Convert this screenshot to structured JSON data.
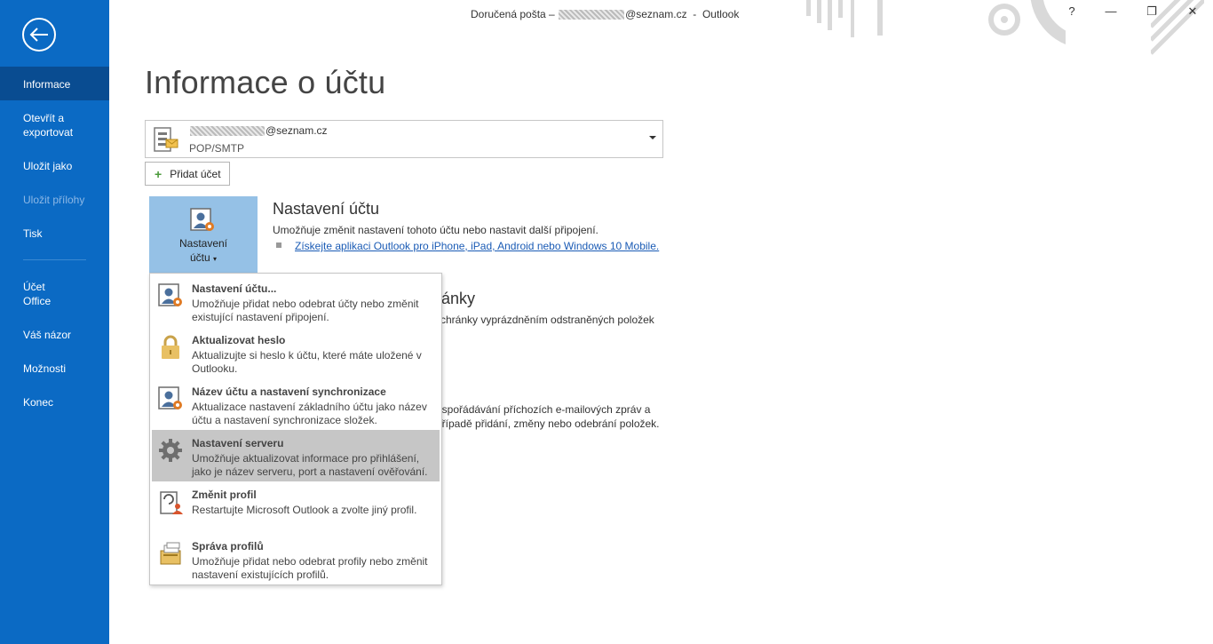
{
  "titlebar": {
    "prefix": "Doručená pošta –",
    "email_suffix": "@seznam.cz",
    "app": "Outlook",
    "help": "?",
    "minimize": "—",
    "restore": "❐",
    "close": "✕"
  },
  "sidebar": {
    "items": [
      {
        "label": "Informace",
        "state": "active"
      },
      {
        "label": "Otevřít a exportovat"
      },
      {
        "label": "Uložit jako"
      },
      {
        "label": "Uložit přílohy",
        "state": "disabled"
      },
      {
        "label": "Tisk"
      },
      {
        "label": "Účet Office"
      },
      {
        "label": "Váš názor"
      },
      {
        "label": "Možnosti"
      },
      {
        "label": "Konec"
      }
    ]
  },
  "page": {
    "title": "Informace o účtu"
  },
  "account": {
    "email_suffix": "@seznam.cz",
    "type": "POP/SMTP",
    "add_label": "Přidat účet"
  },
  "tile": {
    "label_line1": "Nastavení",
    "label_line2": "účtu"
  },
  "section_settings": {
    "title": "Nastavení účtu",
    "desc": "Umožňuje změnit nastavení tohoto účtu nebo nastavit další připojení.",
    "link": "Získejte aplikaci Outlook pro iPhone, iPad, Android nebo Windows 10 Mobile."
  },
  "section_mailbox": {
    "title_fragment": "ránky",
    "desc_fragment": "schránky vyprázdněním odstraněných položek"
  },
  "section_rules": {
    "desc_line1": "uspořádávání příchozích e-mailových zpráv a",
    "desc_line2": "případě přidání, změny nebo odebrání položek."
  },
  "menu": {
    "items": [
      {
        "title": "Nastavení účtu...",
        "desc": "Umožňuje přidat nebo odebrat účty nebo změnit existující nastavení připojení.",
        "icon": "account-settings-icon"
      },
      {
        "title": "Aktualizovat heslo",
        "desc": "Aktualizujte si heslo k účtu, které máte uložené v Outlooku.",
        "icon": "lock-icon"
      },
      {
        "title": "Název účtu a nastavení synchronizace",
        "desc": "Aktualizace nastavení základního účtu jako název účtu a nastavení synchronizace složek.",
        "icon": "account-sync-icon"
      },
      {
        "title": "Nastavení serveru",
        "desc": "Umožňuje aktualizovat informace pro přihlášení, jako je název serveru, port a nastavení ověřování.",
        "icon": "gear-icon"
      },
      {
        "title": "Změnit profil",
        "desc": "Restartujte Microsoft Outlook a zvolte jiný profil.",
        "icon": "change-profile-icon"
      },
      {
        "title": "Správa profilů",
        "desc": "Umožňuje přidat nebo odebrat profily nebo změnit nastavení existujících profilů.",
        "icon": "manage-profiles-icon"
      }
    ]
  },
  "colors": {
    "sidebar": "#0b6ac4",
    "sidebar_active": "#094c91",
    "tile": "#95c1e6",
    "link": "#1a5bb5",
    "menu_hover": "#c6c6c6"
  }
}
